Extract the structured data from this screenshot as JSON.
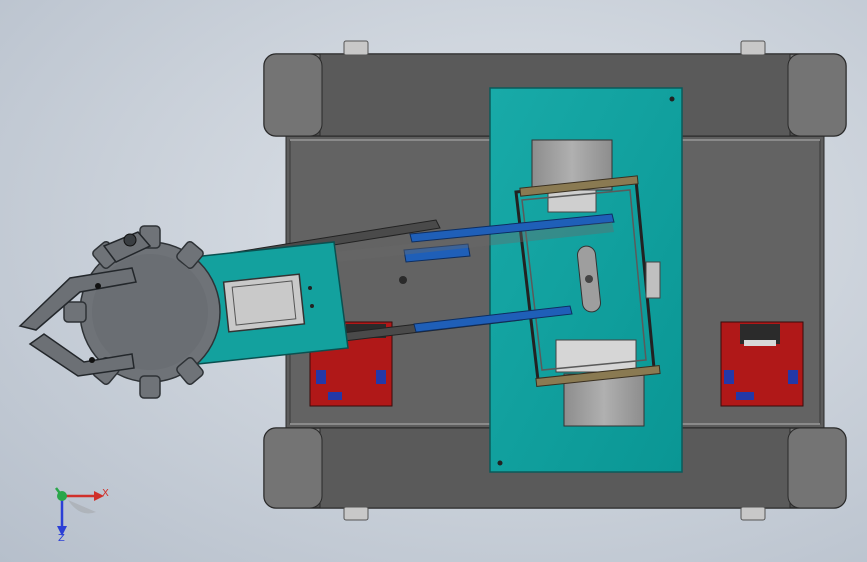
{
  "viewport": {
    "background": "#c9d0d9"
  },
  "model": {
    "components": [
      "robot-chassis",
      "left-track",
      "right-track",
      "mount-plate",
      "robotic-arm",
      "gripper",
      "gear",
      "servo-motor",
      "motor-driver-board-left",
      "motor-driver-board-right"
    ],
    "colors": {
      "chassis": "#5f5f5f",
      "track": "#6b6b6b",
      "plate": "#0fa1a0",
      "board": "#b01818",
      "servo": "#9a9a9a",
      "link_blue": "#1f5fb8"
    }
  },
  "triad": {
    "x_label": "X",
    "z_label": "Z",
    "colors": {
      "x": "#d0302a",
      "y": "#2aa64a",
      "z": "#2b3fd6"
    }
  }
}
